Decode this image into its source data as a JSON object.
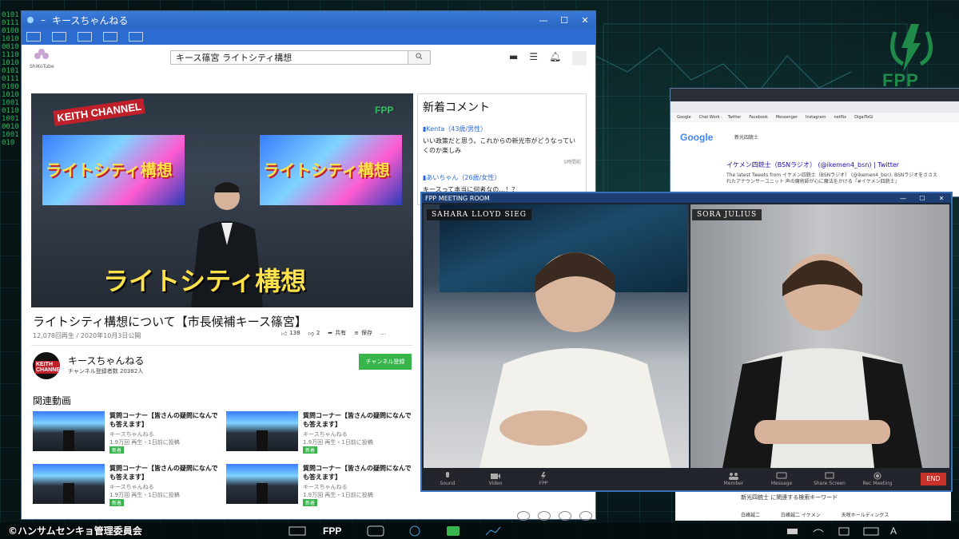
{
  "browser": {
    "title": "キースちゃんねる",
    "site_name": "ShiKoTube",
    "search_value": "キース篠宮 ライトシティ構想"
  },
  "video": {
    "screen_text": "ライトシティ構想",
    "overlay_title": "ライトシティ構想",
    "brand": "KEITH CHANNEL",
    "fpp": "FPP",
    "title": "ライトシティ構想について【市長候補キース篠宮】",
    "meta": "12,078回再生 / 2020年10月3日公開",
    "likes": "138",
    "dislikes": "2",
    "share_label": "共有",
    "save_label": "保存",
    "more_label": "…"
  },
  "channel": {
    "name": "キースちゃんねる",
    "subscribers": "チャンネル登録者数 20382人",
    "subscribe_label": "チャンネル登録",
    "avatar_text": "KEITH CHANNEL"
  },
  "related": {
    "heading": "関連動画",
    "items": [
      {
        "title": "質問コーナー【皆さんの疑問になんでも答えます】",
        "channel": "キースちゃんねる",
        "meta": "1.9万回 再生・1日前に投稿",
        "badge": "新着"
      },
      {
        "title": "質問コーナー【皆さんの疑問になんでも答えます】",
        "channel": "キースちゃんねる",
        "meta": "1.9万回 再生・1日前に投稿",
        "badge": "新着"
      },
      {
        "title": "質問コーナー【皆さんの疑問になんでも答えます】",
        "channel": "キースちゃんねる",
        "meta": "1.9万回 再生・1日前に投稿",
        "badge": "新着"
      },
      {
        "title": "質問コーナー【皆さんの疑問になんでも答えます】",
        "channel": "キースちゃんねる",
        "meta": "1.9万回 再生・1日前に投稿",
        "badge": "新着"
      }
    ]
  },
  "comments": {
    "heading": "新着コメント",
    "items": [
      {
        "user": "▮Kenta（43歳/男性）",
        "text": "いい政策だと思う。これからの新光市がどうなっていくのか楽しみ",
        "time": "5時間前"
      },
      {
        "user": "▮あいちゃん（26歳/女性）",
        "text": "キースって本当に何者なの…！？"
      }
    ]
  },
  "google": {
    "logo": "Google",
    "search": "新光四銃士",
    "bookmarks": [
      "Google",
      "Chat Work",
      "Twitter",
      "Facebook",
      "Messenger",
      "Instagram",
      "netflix",
      "DigaiToGi"
    ],
    "result_title": "イケメン四銃士（BSNラジオ） (@ikemen4_bsn) | Twitter",
    "result_snippet": "The latest Tweets from イケメン四銃士（BSNラジオ） (@ikemen4_bsn). BSNラジオをささえれたアナウンサーユニット 声の魔術師が心に魔法をかける『#イケメン四銃士』"
  },
  "search_list": {
    "heading": "新光四銃士 に関連する検索キーワード",
    "items": [
      "白峰誠二",
      "白峰誠二 イケメン",
      "天咲ホールディングス"
    ]
  },
  "meeting": {
    "title": "FPP MEETING ROOM",
    "left_name": "SAHARA LLOYD SIEG",
    "right_name": "SORA JULIUS",
    "controls": [
      "Sound",
      "Video",
      "FPP",
      "Member",
      "Message",
      "Share Screen",
      "Rec Meeting"
    ],
    "end_label": "END"
  },
  "copyright": "©ハンサムセンキョ管理委員会",
  "background": {
    "logo_text": "FPP",
    "binary": "0101011101001010001011101010010101110100101010010110100100101001010"
  },
  "colors": {
    "accent": "#37b54a",
    "titlebar": "#2a66c4",
    "end": "#c83228"
  }
}
